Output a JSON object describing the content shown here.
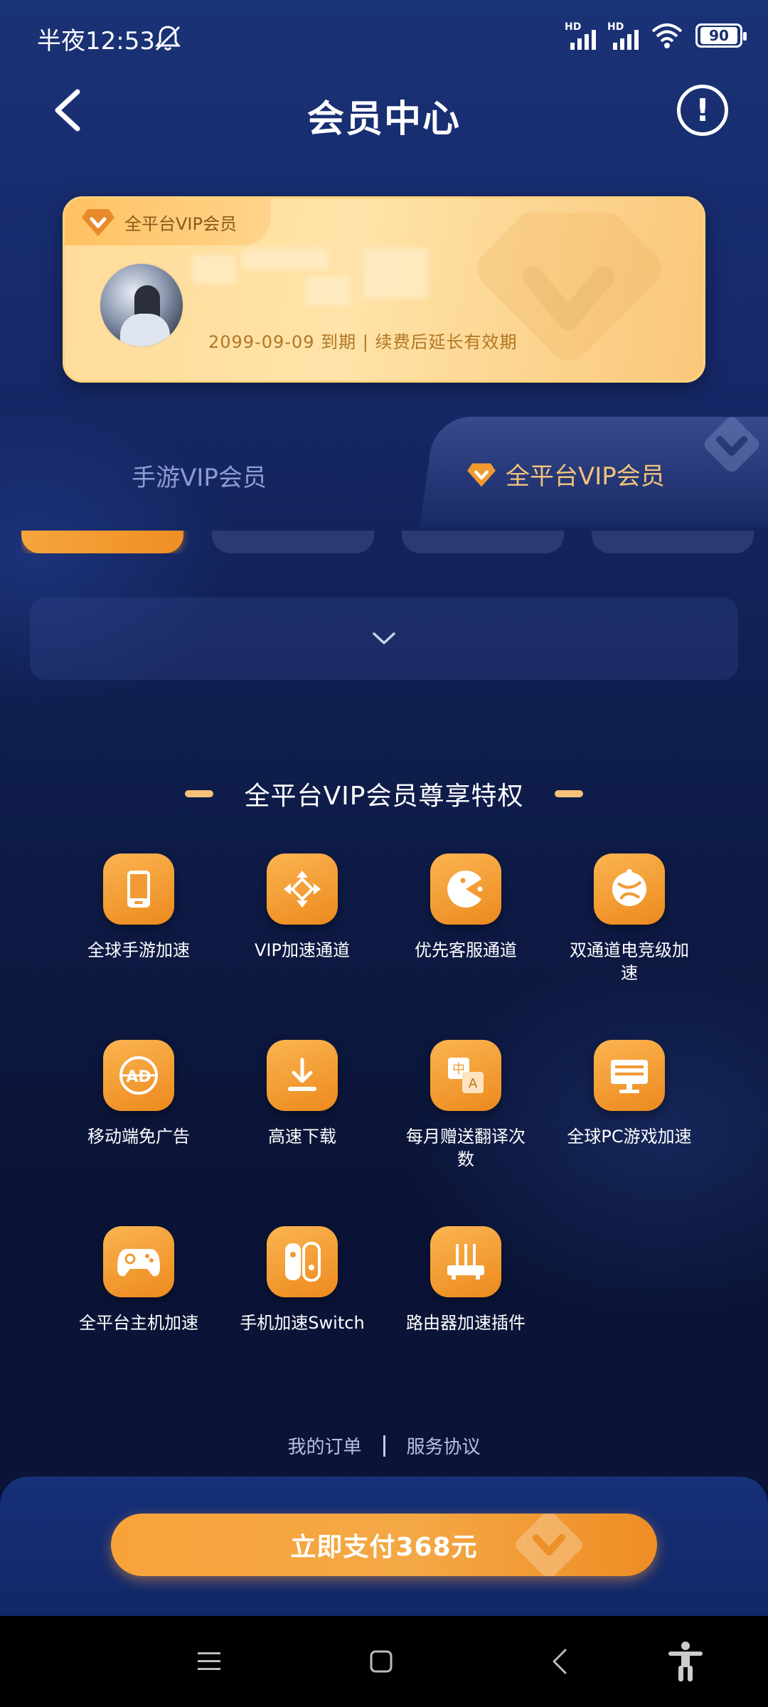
{
  "status_bar": {
    "time": "半夜12:53",
    "hd1": "HD",
    "hd2": "HD",
    "battery": "90"
  },
  "header": {
    "title": "会员中心"
  },
  "member_card": {
    "badge_label": "全平台VIP会员",
    "expire_text": "2099-09-09 到期  |  续费后延长有效期"
  },
  "tabs": [
    {
      "label": "手游VIP会员"
    },
    {
      "label": "全平台VIP会员"
    }
  ],
  "privileges": {
    "title": "全平台VIP会员尊享特权",
    "items": [
      {
        "label": "全球手游加速",
        "icon": "phone-icon"
      },
      {
        "label": "VIP加速通道",
        "icon": "diamond-arrows-icon"
      },
      {
        "label": "优先客服通道",
        "icon": "pacman-icon"
      },
      {
        "label": "双通道电竞级加速",
        "icon": "globe-icon"
      },
      {
        "label": "移动端免广告",
        "icon": "ad-block-icon"
      },
      {
        "label": "高速下载",
        "icon": "download-icon"
      },
      {
        "label": "每月赠送翻译次数",
        "icon": "translate-icon"
      },
      {
        "label": "全球PC游戏加速",
        "icon": "monitor-icon"
      },
      {
        "label": "全平台主机加速",
        "icon": "gamepad-icon"
      },
      {
        "label": "手机加速Switch",
        "icon": "switch-icon"
      },
      {
        "label": "路由器加速插件",
        "icon": "router-icon"
      }
    ]
  },
  "footer": {
    "orders": "我的订单",
    "agreement": "服务协议"
  },
  "pay": {
    "label": "立即支付368元"
  },
  "colors": {
    "accent": "#f29a30",
    "background": "#0e1b44",
    "gold_card": "#ffdc9a"
  }
}
